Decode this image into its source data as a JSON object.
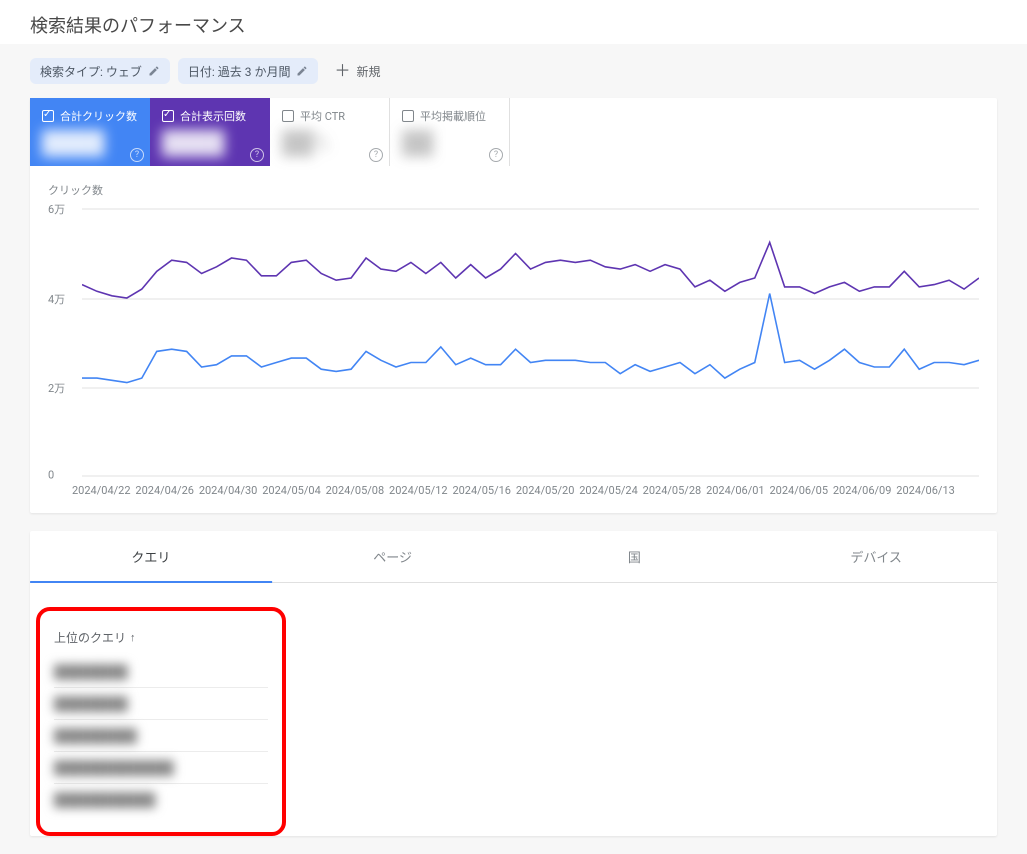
{
  "colors": {
    "clicks": "#4285f4",
    "impressions": "#5e35b1",
    "grid": "#e0e0e0",
    "highlight_border": "#ff0000"
  },
  "header": {
    "title": "検索結果のパフォーマンス"
  },
  "filters": {
    "chips": [
      {
        "label": "検索タイプ: ウェブ"
      },
      {
        "label": "日付: 過去 3 か月間"
      }
    ],
    "add_label": "新規"
  },
  "metrics": {
    "clicks": {
      "label": "合計クリック数",
      "value": "████",
      "checked": true,
      "style": "blue"
    },
    "impressions": {
      "label": "合計表示回数",
      "value": "████",
      "checked": true,
      "style": "purple"
    },
    "ctr": {
      "label": "平均 CTR",
      "value": "██%",
      "checked": false
    },
    "position": {
      "label": "平均掲載順位",
      "value": "██",
      "checked": false
    }
  },
  "chart_data": {
    "type": "line",
    "y_title_left": "クリック数",
    "ylim": [
      0,
      60000
    ],
    "y_ticks": [
      "6万",
      "4万",
      "2万",
      "0"
    ],
    "categories": [
      "2024/04/22",
      "2024/04/26",
      "2024/04/30",
      "2024/05/04",
      "2024/05/08",
      "2024/05/12",
      "2024/05/16",
      "2024/05/20",
      "2024/05/24",
      "2024/05/28",
      "2024/06/01",
      "2024/06/05",
      "2024/06/09",
      "2024/06/13"
    ],
    "series": [
      {
        "name": "合計クリック数",
        "color": "#4285f4",
        "values": [
          22000,
          22000,
          21500,
          21000,
          22000,
          28000,
          28500,
          28000,
          24500,
          25000,
          27000,
          27000,
          24500,
          25500,
          26500,
          26500,
          24000,
          23500,
          24000,
          28000,
          26000,
          24500,
          25500,
          25500,
          29000,
          25000,
          26500,
          25000,
          25000,
          28500,
          25500,
          26000,
          26000,
          26000,
          25500,
          25500,
          23000,
          25000,
          23500,
          24500,
          25500,
          23000,
          25000,
          22000,
          24000,
          25500,
          41000,
          25500,
          26000,
          24000,
          26000,
          28500,
          25500,
          24500,
          24500,
          28500,
          24000,
          25500,
          25500,
          25000,
          26000
        ]
      },
      {
        "name": "合計表示回数",
        "color": "#5e35b1",
        "values": [
          43000,
          41500,
          40500,
          40000,
          42000,
          46000,
          48500,
          48000,
          45500,
          47000,
          49000,
          48500,
          45000,
          45000,
          48000,
          48500,
          45500,
          44000,
          44500,
          49000,
          46500,
          46000,
          48000,
          45500,
          48000,
          44500,
          47500,
          44500,
          46500,
          50000,
          46500,
          48000,
          48500,
          48000,
          48500,
          47000,
          46500,
          47500,
          46000,
          47500,
          46500,
          42500,
          44000,
          41500,
          43500,
          44500,
          52500,
          42500,
          42500,
          41000,
          42500,
          43500,
          41500,
          42500,
          42500,
          46000,
          42500,
          43000,
          44000,
          42000,
          44500
        ]
      }
    ]
  },
  "tabs": [
    {
      "label": "クエリ",
      "active": true
    },
    {
      "label": "ページ",
      "active": false
    },
    {
      "label": "国",
      "active": false
    },
    {
      "label": "デバイス",
      "active": false
    }
  ],
  "queries": {
    "header_label": "上位のクエリ",
    "rows": [
      {
        "text": "████████"
      },
      {
        "text": "████████"
      },
      {
        "text": "█████████"
      },
      {
        "text": "█████████████"
      },
      {
        "text": "███████████"
      }
    ]
  }
}
